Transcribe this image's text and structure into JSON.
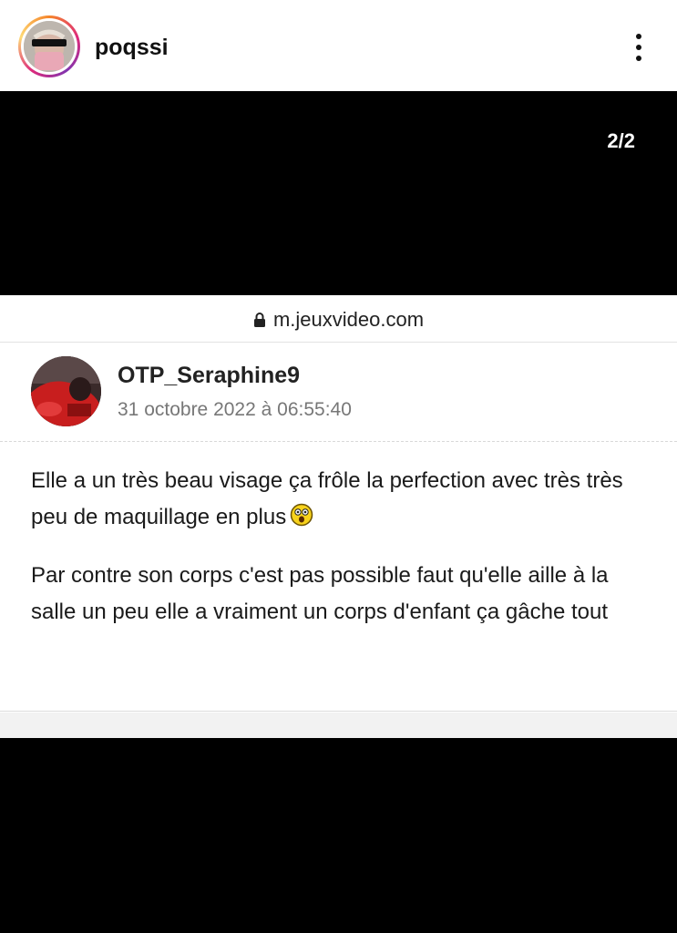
{
  "header": {
    "username": "poqssi",
    "more_icon": "more-vertical-icon"
  },
  "media": {
    "page_counter": "2/2"
  },
  "browser": {
    "lock_icon": "lock-icon",
    "url": "m.jeuxvideo.com"
  },
  "post": {
    "author": "OTP_Seraphine9",
    "date": "31 octobre 2022 à 06:55:40",
    "paragraph_1": "Elle a un très beau visage ça frôle la perfection avec très très peu de maquillage en plus",
    "paragraph_1_emoji": "shocked-smiley-icon",
    "paragraph_2": "Par contre son corps c'est pas possible faut qu'elle aille à la salle un peu elle a vraiment un corps d'enfant ça gâche tout"
  },
  "colors": {
    "story_ring": "#dd2a7b",
    "text": "#1a1a1a",
    "date": "#777777",
    "media_bg": "#000000"
  }
}
